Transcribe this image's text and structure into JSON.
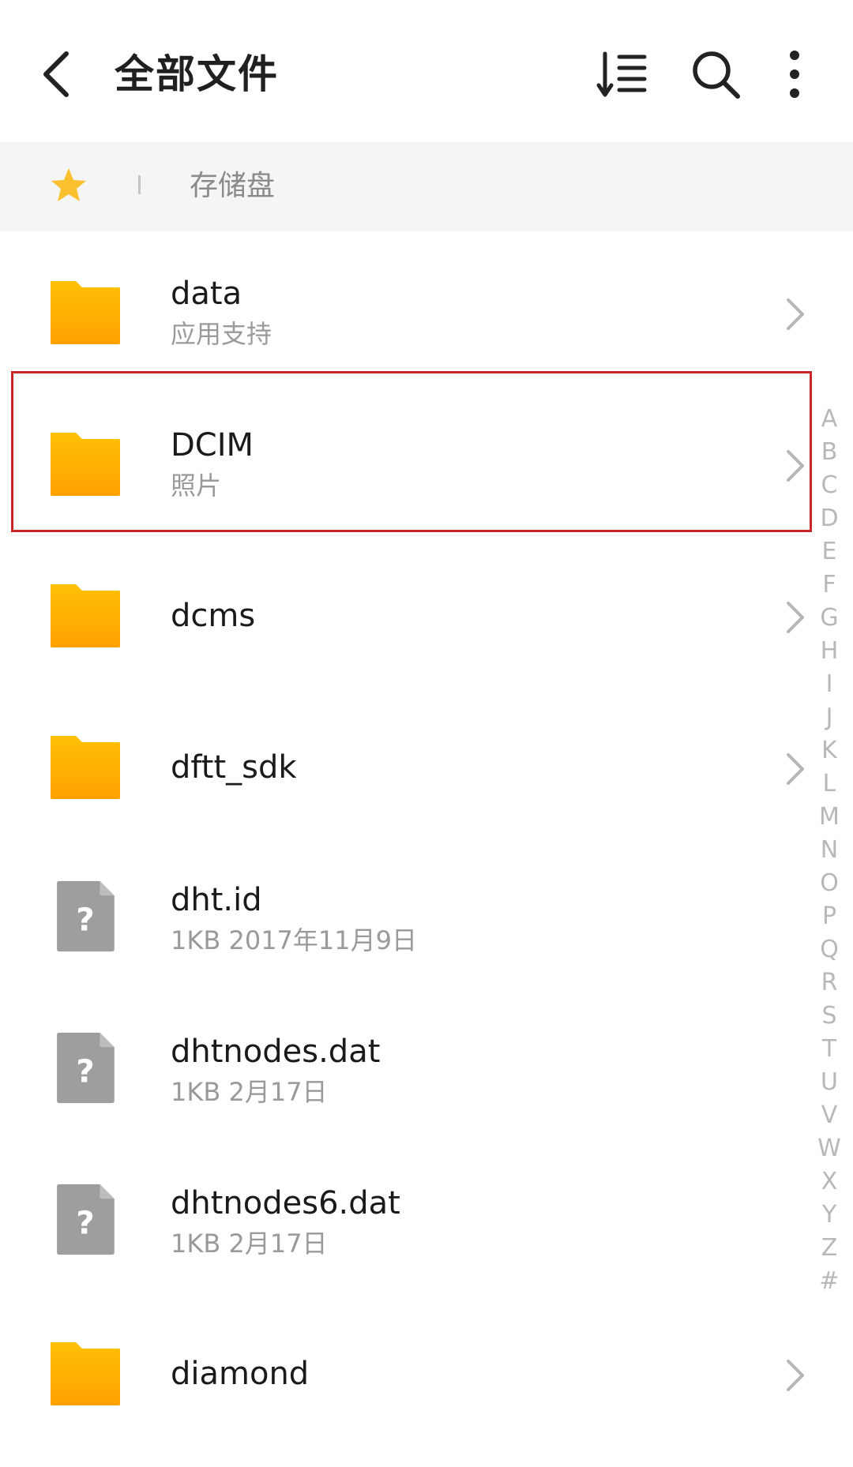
{
  "header": {
    "title": "全部文件",
    "back_icon": "chevron-left-icon",
    "sort_icon": "sort-list-icon",
    "search_icon": "search-icon",
    "more_icon": "more-vertical-icon"
  },
  "breadcrumb": {
    "favorite_icon": "star-icon",
    "storage_label": "存储盘"
  },
  "files": [
    {
      "name": "data",
      "sub": "应用支持",
      "type": "folder"
    },
    {
      "name": "DCIM",
      "sub": "照片",
      "type": "folder"
    },
    {
      "name": "dcms",
      "sub": "",
      "type": "folder"
    },
    {
      "name": "dftt_sdk",
      "sub": "",
      "type": "folder"
    },
    {
      "name": "dht.id",
      "sub": "1KB  2017年11月9日",
      "type": "unknown-file"
    },
    {
      "name": "dhtnodes.dat",
      "sub": "1KB  2月17日",
      "type": "unknown-file"
    },
    {
      "name": "dhtnodes6.dat",
      "sub": "1KB  2月17日",
      "type": "unknown-file"
    },
    {
      "name": "diamond",
      "sub": "",
      "type": "folder"
    }
  ],
  "alphabet": [
    "A",
    "B",
    "C",
    "D",
    "E",
    "F",
    "G",
    "H",
    "I",
    "J",
    "K",
    "L",
    "M",
    "N",
    "O",
    "P",
    "Q",
    "R",
    "S",
    "T",
    "U",
    "V",
    "W",
    "X",
    "Y",
    "Z",
    "#"
  ],
  "colors": {
    "folder": "#FFB300",
    "folder_light": "#FFC107",
    "file_icon": "#9E9E9E",
    "star": "#FBC02D",
    "highlight": "#C62828"
  }
}
